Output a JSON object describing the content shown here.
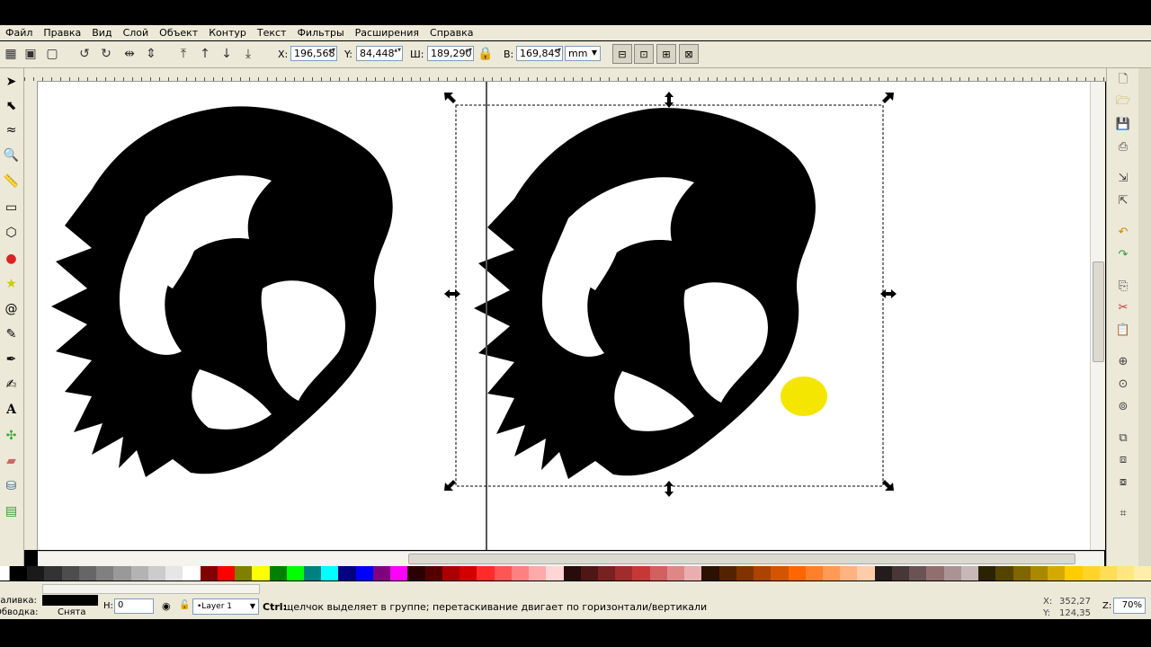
{
  "menu": [
    "Файл",
    "Правка",
    "Вид",
    "Слой",
    "Объект",
    "Контур",
    "Текст",
    "Фильтры",
    "Расширения",
    "Справка"
  ],
  "toolbar": {
    "x_label": "X:",
    "x_value": "196,568",
    "y_label": "Y:",
    "y_value": "84,448",
    "w_label": "Ш:",
    "w_value": "189,290",
    "h_label": "В:",
    "h_value": "169,843",
    "unit": "mm"
  },
  "status": {
    "fill_label": "Заливка:",
    "stroke_label": "Обводка:",
    "stroke_value": "Снята",
    "h_label": "H:",
    "h_value": "0",
    "layer": "•Layer 1",
    "message_key": "Ctrl:",
    "message": "щелчок выделяет в группе; перетаскивание двигает по горизонтали/вертикали",
    "coord_x_label": "X:",
    "coord_x": "352,27",
    "coord_y_label": "Y:",
    "coord_y": "124,35",
    "zoom_label": "Z:",
    "zoom": "70%"
  },
  "colors": {
    "ui_bg": "#ece9d8",
    "canvas": "#ffffff",
    "highlight": "#f5e600"
  }
}
